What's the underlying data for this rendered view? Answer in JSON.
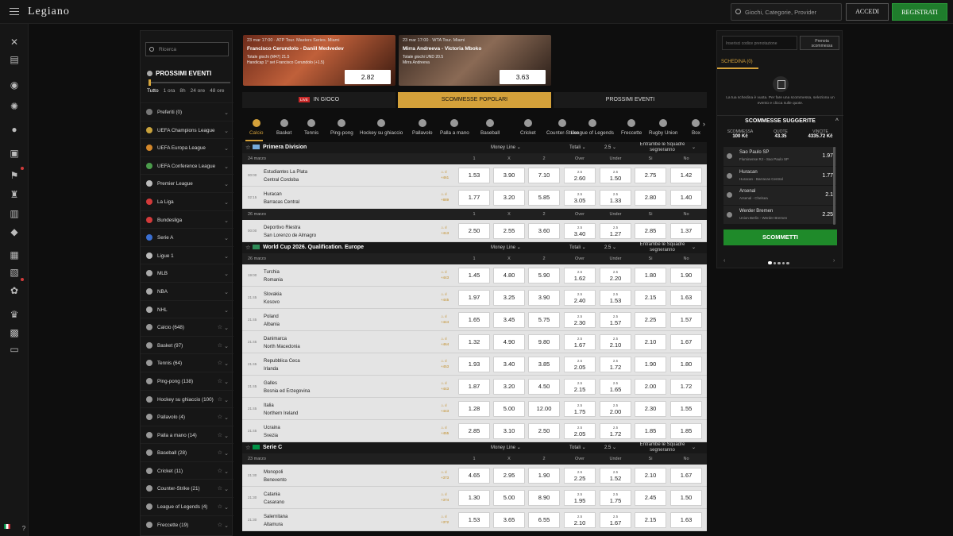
{
  "header": {
    "brand": "Legiano",
    "search_placeholder": "Giochi, Categorie, Provider",
    "login": "ACCEDI",
    "register": "REGISTRATI"
  },
  "leftnav": {
    "search_placeholder": "Ricerca",
    "title": "PROSSIMI EVENTI",
    "times": [
      "Tutto",
      "1 ora",
      "8h",
      "24 ore",
      "48 ore"
    ],
    "items": [
      "Preferiti (0)",
      "UEFA Champions League",
      "UEFA Europa League",
      "UEFA Conference League",
      "Premier League",
      "La Liga",
      "Bundesliga",
      "Serie A",
      "Ligue 1",
      "MLB",
      "NBA",
      "NHL",
      "Calcio (648)",
      "Basket (97)",
      "Tennis (64)",
      "Ping-pong (138)",
      "Hockey su ghiaccio (100)",
      "Pallavolo (4)",
      "Palla a mano (14)",
      "Baseball (28)",
      "Cricket (11)",
      "Counter-Strike (21)",
      "League of Legends (4)",
      "Freccette (19)"
    ]
  },
  "promos": [
    {
      "league": "23 mar 17:00 · ATP Tour. Masters Series. Miami",
      "match": "Francisco Cerundolo - Daniil Medvedev",
      "line1": "Totale giochi (M47) 21.5",
      "line2": "Handicap 1° set Francisco Cerundolo (+1.5)",
      "odd": "2.82"
    },
    {
      "league": "23 mar 17:00 · WTA Tour. Miami",
      "match": "Mirra Andreeva - Victoria Mboko",
      "line1": "Totale giochi UND 20.5",
      "line2": "Mirra Andreeva",
      "odd": "3.63"
    }
  ],
  "tabs": {
    "live_badge": "LIVE",
    "live": "IN GIOCO",
    "popular": "SCOMMESSE POPOLARI",
    "next": "PROSSIMI EVENTI"
  },
  "sports": [
    "Calcio",
    "Basket",
    "Tennis",
    "Ping-pong",
    "Hockey su ghiaccio",
    "Pallavolo",
    "Palla a mano",
    "Baseball",
    "Cricket",
    "Counter-Strike",
    "League of Legends",
    "Freccette",
    "Rugby Union",
    "Box"
  ],
  "market_headers": {
    "moneyline": "Money Line",
    "totals": "Totali",
    "total_line": "2.5",
    "btts": "Entrambe le Squadre segneranno",
    "c1": "1",
    "cx": "X",
    "c2": "2",
    "over": "Over",
    "under": "Under",
    "yes": "Si",
    "no": "No"
  },
  "leagues": [
    {
      "name": "Primera Division",
      "flag": "#75aadb",
      "groups": [
        {
          "date": "24 marzo",
          "events": [
            {
              "time": "00:00",
              "home": "Estudiantes La Plata",
              "away": "Central Cordoba",
              "more": "+461",
              "o": [
                "1.53",
                "3.90",
                "7.10"
              ],
              "ov": "2.60",
              "un": "1.50",
              "line": "2.5",
              "si": "2.75",
              "no": "1.42"
            },
            {
              "time": "02:15",
              "home": "Huracan",
              "away": "Barracas Central",
              "more": "+889",
              "o": [
                "1.77",
                "3.20",
                "5.85"
              ],
              "ov": "3.05",
              "un": "1.33",
              "line": "2.5",
              "si": "2.80",
              "no": "1.40"
            }
          ]
        },
        {
          "date": "26 marzo",
          "events": [
            {
              "time": "00:00",
              "home": "Deportivo Riestra",
              "away": "San Lorenzo de Almagro",
              "more": "+413",
              "o": [
                "2.50",
                "2.55",
                "3.60"
              ],
              "ov": "3.40",
              "un": "1.27",
              "line": "2.5",
              "si": "2.85",
              "no": "1.37"
            }
          ]
        }
      ]
    },
    {
      "name": "World Cup 2026. Qualification. Europe",
      "flag": "#2e8b57",
      "groups": [
        {
          "date": "26 marzo",
          "events": [
            {
              "time": "19:00",
              "home": "Turchia",
              "away": "Romania",
              "more": "+443",
              "o": [
                "1.45",
                "4.80",
                "5.90"
              ],
              "ov": "1.62",
              "un": "2.20",
              "line": "2.5",
              "si": "1.80",
              "no": "1.90"
            },
            {
              "time": "21:45",
              "home": "Slovakia",
              "away": "Kosovo",
              "more": "+445",
              "o": [
                "1.97",
                "3.25",
                "3.90"
              ],
              "ov": "2.40",
              "un": "1.53",
              "line": "2.5",
              "si": "2.15",
              "no": "1.63"
            },
            {
              "time": "21:45",
              "home": "Poland",
              "away": "Albania",
              "more": "+444",
              "o": [
                "1.65",
                "3.45",
                "5.75"
              ],
              "ov": "2.30",
              "un": "1.57",
              "line": "2.5",
              "si": "2.25",
              "no": "1.57"
            },
            {
              "time": "21:45",
              "home": "Danimarca",
              "away": "North Macedonia",
              "more": "+464",
              "o": [
                "1.32",
                "4.90",
                "9.80"
              ],
              "ov": "1.67",
              "un": "2.10",
              "line": "2.5",
              "si": "2.10",
              "no": "1.67"
            },
            {
              "time": "21:45",
              "home": "Repubblica Ceca",
              "away": "Irlanda",
              "more": "+453",
              "o": [
                "1.93",
                "3.40",
                "3.85"
              ],
              "ov": "2.05",
              "un": "1.72",
              "line": "2.5",
              "si": "1.90",
              "no": "1.80"
            },
            {
              "time": "21:45",
              "home": "Galles",
              "away": "Bosnia ed Erzegovina",
              "more": "+443",
              "o": [
                "1.87",
                "3.20",
                "4.50"
              ],
              "ov": "2.15",
              "un": "1.65",
              "line": "2.5",
              "si": "2.00",
              "no": "1.72"
            },
            {
              "time": "21:45",
              "home": "Italia",
              "away": "Northern Ireland",
              "more": "+443",
              "o": [
                "1.28",
                "5.00",
                "12.00"
              ],
              "ov": "1.75",
              "un": "2.00",
              "line": "2.5",
              "si": "2.30",
              "no": "1.55"
            },
            {
              "time": "21:45",
              "home": "Ucraina",
              "away": "Svezia",
              "more": "+455",
              "o": [
                "2.85",
                "3.10",
                "2.50"
              ],
              "ov": "2.05",
              "un": "1.72",
              "line": "2.5",
              "si": "1.85",
              "no": "1.85"
            }
          ]
        }
      ]
    },
    {
      "name": "Serie C",
      "flag": "#009246",
      "groups": [
        {
          "date": "23 marzo",
          "events": [
            {
              "time": "21:30",
              "home": "Monopoli",
              "away": "Benevento",
              "more": "+373",
              "o": [
                "4.65",
                "2.95",
                "1.90"
              ],
              "ov": "2.25",
              "un": "1.52",
              "line": "2.5",
              "si": "2.10",
              "no": "1.67"
            },
            {
              "time": "21:30",
              "home": "Catania",
              "away": "Casarano",
              "more": "+374",
              "o": [
                "1.30",
                "5.00",
                "8.90"
              ],
              "ov": "1.95",
              "un": "1.75",
              "line": "2.5",
              "si": "2.45",
              "no": "1.50"
            },
            {
              "time": "21:30",
              "home": "Salernitana",
              "away": "Altamura",
              "more": "+372",
              "o": [
                "1.53",
                "3.65",
                "6.55"
              ],
              "ov": "2.10",
              "un": "1.67",
              "line": "2.5",
              "si": "2.15",
              "no": "1.63"
            }
          ]
        }
      ]
    }
  ],
  "betslip": {
    "code_placeholder": "Inserisci codice prenotazione",
    "code_btn": "Prenota scommessa",
    "tab": "SCHEDINA (0)",
    "empty": "La tua schedina è vuota. Per fare una scommessa, seleziona un evento e clicca sulle quote.",
    "sug_title": "SCOMMESSE SUGGERITE",
    "stake_label": "SCOMMESSA",
    "stake": "100 Kč",
    "odds_label": "QUOTE",
    "odds": "43.35",
    "win_label": "VINCITE",
    "win": "4335.72 Kč",
    "picks": [
      {
        "name": "Sao Paulo SP",
        "match": "Fluminense RJ - Sao Paulo SP",
        "odd": "1.97"
      },
      {
        "name": "Huracan",
        "match": "Huracan - Barracas Central",
        "odd": "1.77"
      },
      {
        "name": "Arsenal",
        "match": "Arsenal - Chelsea",
        "odd": "2.1"
      },
      {
        "name": "Werder Bremen",
        "match": "Union Berlin - Werder Bremen",
        "odd": "2.25"
      }
    ],
    "bet_btn": "SCOMMETTI"
  }
}
